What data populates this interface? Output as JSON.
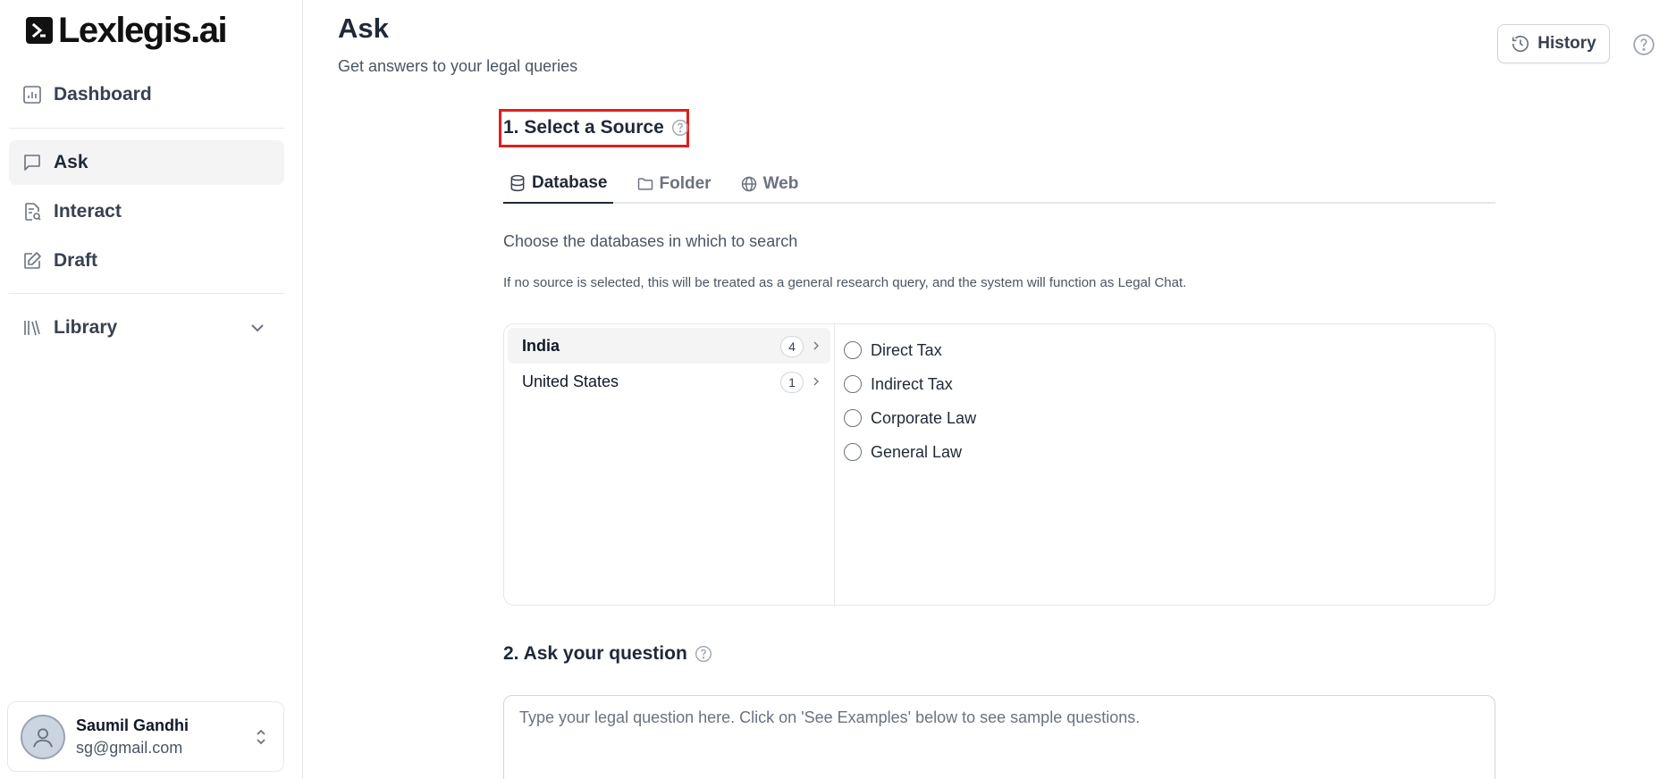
{
  "brand": {
    "name": "Lexlegis.ai"
  },
  "sidebar": {
    "items": [
      {
        "label": "Dashboard",
        "icon": "chart-icon",
        "active": false
      },
      {
        "label": "Ask",
        "icon": "message-icon",
        "active": true
      },
      {
        "label": "Interact",
        "icon": "document-search-icon",
        "active": false
      },
      {
        "label": "Draft",
        "icon": "edit-icon",
        "active": false
      },
      {
        "label": "Library",
        "icon": "library-icon",
        "active": false
      }
    ]
  },
  "user": {
    "name": "Saumil Gandhi",
    "email": "sg@gmail.com"
  },
  "header": {
    "title": "Ask",
    "subtitle": "Get answers to your legal queries",
    "history_label": "History"
  },
  "section1": {
    "title": "1. Select a Source",
    "tabs": [
      {
        "label": "Database",
        "active": true
      },
      {
        "label": "Folder",
        "active": false
      },
      {
        "label": "Web",
        "active": false
      }
    ],
    "choose_text": "Choose the databases in which to search",
    "note": "If no source is selected, this will be treated as a general research query, and the system will function as Legal Chat.",
    "countries": [
      {
        "name": "India",
        "count": "4",
        "active": true
      },
      {
        "name": "United States",
        "count": "1",
        "active": false
      }
    ],
    "databases": [
      "Direct Tax",
      "Indirect Tax",
      "Corporate Law",
      "General Law"
    ]
  },
  "section2": {
    "title": "2. Ask your question",
    "placeholder": "Type your legal question here. Click on 'See Examples' below to see sample questions."
  },
  "colors": {
    "highlight": "#e11d1d",
    "active_bg": "#f4f4f5",
    "border": "#e5e7eb"
  }
}
